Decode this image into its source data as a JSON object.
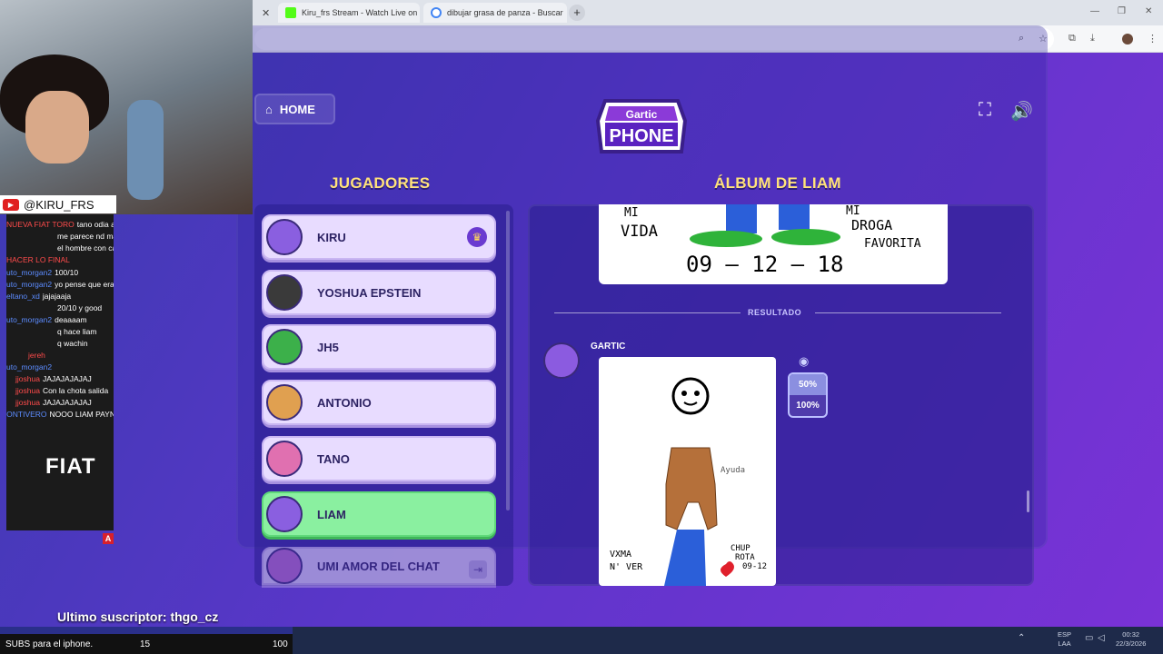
{
  "browser": {
    "tabs": [
      {
        "title": "Kiru_frs Stream - Watch Live on",
        "icon": "kick-icon",
        "color": "#53fc18"
      },
      {
        "title": "dibujar grasa de panza - Buscar",
        "icon": "google-icon",
        "color": "#4285f4"
      }
    ],
    "new_tab": "+",
    "window": {
      "minimize": "—",
      "restore": "❐",
      "close": "✕"
    }
  },
  "game": {
    "home_label": "HOME",
    "logo_top": "Gartic",
    "logo_bottom": "PHONE",
    "players_heading": "JUGADORES",
    "album_heading": "ÁLBUM DE LIAM",
    "players": [
      {
        "name": "KIRU",
        "badge": "crown-icon",
        "active": false,
        "color": "#8a5fe0"
      },
      {
        "name": "YOSHUA EPSTEIN",
        "active": false,
        "color": "#3a3a3a"
      },
      {
        "name": "JH5",
        "active": false,
        "color": "#3cb04a"
      },
      {
        "name": "ANTONIO",
        "active": false,
        "color": "#e0a050"
      },
      {
        "name": "TANO",
        "active": false,
        "color": "#e070b0"
      },
      {
        "name": "LIAM",
        "active": true,
        "color": "#8a5fe0"
      },
      {
        "name": "UMI AMOR DEL CHAT",
        "active": false,
        "faded": true,
        "color": "#c070d0"
      }
    ],
    "album": {
      "top_card_text": [
        "MI",
        "VIDA",
        "MI",
        "DROGA",
        "FAVORITA",
        "09 — 12 — 18"
      ],
      "result_label": "RESULTADO",
      "author": "GARTIC",
      "drawing_text": [
        "Ayuda",
        "VXMA",
        "N' VER",
        "CHUP",
        "ROTA",
        "09-12"
      ],
      "zoom": [
        "50%",
        "100%"
      ],
      "zoom_selected": "50%"
    }
  },
  "stream": {
    "channel": "@KIRU_FRS",
    "chat": [
      {
        "user": "NUEVA FIAT TORO",
        "text": "tano odia a jereh",
        "color": "red"
      },
      {
        "user": "",
        "text": "me parece nd mas",
        "color": "red"
      },
      {
        "user": "",
        "text": "el hombre con cabeza de chota",
        "color": "blue"
      },
      {
        "user": "HACER LO FINAL",
        "text": "",
        "color": "red"
      },
      {
        "user": "uto_morgan2",
        "text": "100/10",
        "color": "blue"
      },
      {
        "user": "uto_morgan2",
        "text": "yo pense que era umi",
        "color": "blue"
      },
      {
        "user": "eltano_xd",
        "text": "jajajaaja",
        "color": "blue"
      },
      {
        "user": "",
        "text": "20/10 y good",
        "color": "red"
      },
      {
        "user": "uto_morgan2",
        "text": "deaaaam",
        "color": "blue"
      },
      {
        "user": "",
        "text": "q hace liam",
        "color": "red"
      },
      {
        "user": "",
        "text": "q wachin",
        "color": "red"
      },
      {
        "user": "jereh",
        "text": "",
        "color": "red"
      },
      {
        "user": "uto_morgan2",
        "text": "",
        "color": "blue"
      },
      {
        "user": "jjoshua",
        "text": "JAJAJAJAJAJ",
        "color": "red"
      },
      {
        "user": "jjoshua",
        "text": "Con la chota salida",
        "color": "red"
      },
      {
        "user": "jjoshua",
        "text": "JAJAJAJAJAJ",
        "color": "red"
      },
      {
        "user": "CONTIVERO",
        "text": "NOOO LIAM PAYNE",
        "color": "blue"
      }
    ],
    "brand": "FIAT",
    "brand_badge": "A",
    "last_sub": "Ultimo suscriptor: thgo_cz",
    "subs_goal": {
      "label": "SUBS para el iphone.",
      "current": "15",
      "target": "100"
    }
  },
  "taskbar": {
    "lang": [
      "ESP",
      "LAA"
    ],
    "time": "00:32",
    "date": "22/3/2026"
  }
}
